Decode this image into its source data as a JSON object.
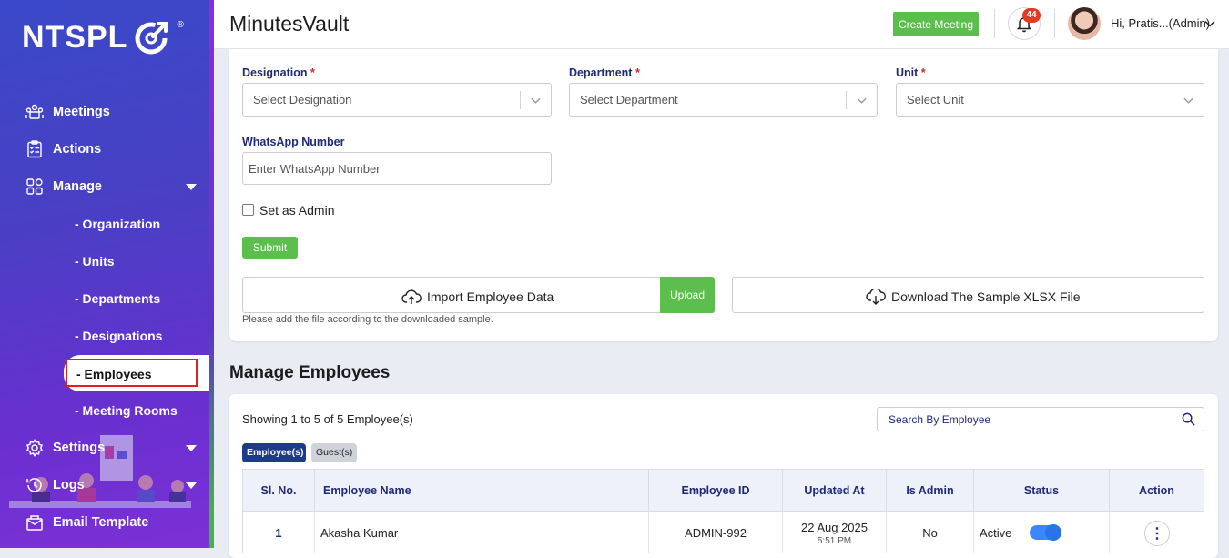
{
  "sidebar": {
    "logo_text": "NTSPL",
    "logo_reg": "®",
    "items": [
      {
        "label": "Meetings",
        "icon": "meetings-icon"
      },
      {
        "label": "Actions",
        "icon": "actions-checklist-icon"
      },
      {
        "label": "Manage",
        "icon": "manage-grid-icon"
      },
      {
        "label": "Settings",
        "icon": "settings-gear-icon"
      },
      {
        "label": "Logs",
        "icon": "logs-clock-icon"
      },
      {
        "label": "Email Template",
        "icon": "email-icon"
      }
    ],
    "manage_sub": [
      "- Organization",
      "- Units",
      "- Departments",
      "- Designations",
      "- Employees",
      "- Meeting Rooms"
    ],
    "accent_color": "#4a3fc4"
  },
  "header": {
    "title": "MinutesVault",
    "create_button": "Create Meeting",
    "notification_count": "44",
    "user_greeting": "Hi, Pratis...(Admin)"
  },
  "form": {
    "designation_label": "Designation",
    "designation_placeholder": "Select Designation",
    "department_label": "Department",
    "department_placeholder": "Select Department",
    "unit_label": "Unit",
    "unit_placeholder": "Select Unit",
    "required_mark": "*",
    "whatsapp_label": "WhatsApp Number",
    "whatsapp_placeholder": "Enter WhatsApp Number",
    "admin_checkbox_label": "Set as Admin",
    "submit_label": "Submit",
    "import_label": "Import Employee Data",
    "upload_label": "Upload",
    "download_label": "Download The Sample XLSX File",
    "hint": "Please add the file according to the downloaded sample."
  },
  "employees": {
    "section_title": "Manage Employees",
    "showing_text": "Showing 1 to 5 of 5 Employee(s)",
    "search_placeholder": "Search By Employee",
    "tabs": [
      "Employee(s)",
      "Guest(s)"
    ],
    "columns": [
      "Sl. No.",
      "Employee Name",
      "Employee ID",
      "Updated At",
      "Is Admin",
      "Status",
      "Action"
    ],
    "rows": [
      {
        "sl": "1",
        "name": "Akasha Kumar",
        "employee_id": "ADMIN-992",
        "updated_date": "22 Aug 2025",
        "updated_time": "5:51 PM",
        "is_admin": "No",
        "status": "Active"
      }
    ]
  },
  "colors": {
    "primary_green": "#5cbf4d",
    "navy": "#1e2a78",
    "required_red": "#e01e2a",
    "badge_red": "#e33a23"
  }
}
